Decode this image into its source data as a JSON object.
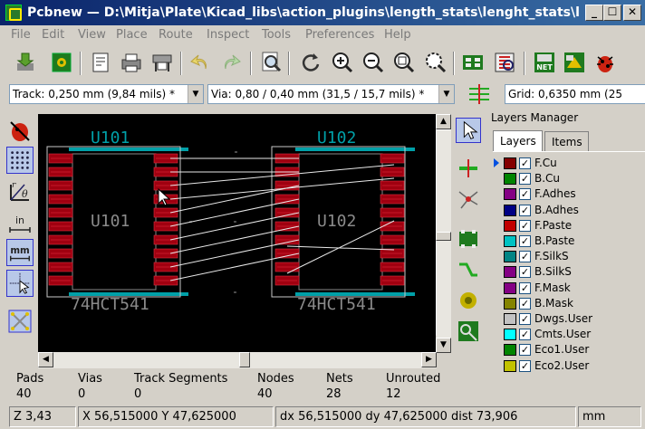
{
  "window": {
    "title": "Pcbnew — D:\\Mitja\\Plate\\Kicad_libs\\action_plugins\\length_stats\\lenght_stats\\lengh...",
    "minimize": "_",
    "maximize": "☐",
    "close": "✕"
  },
  "menu": [
    "File",
    "Edit",
    "View",
    "Place",
    "Route",
    "Inspect",
    "Tools",
    "Preferences",
    "Help"
  ],
  "toolbar_icons": [
    "new-board-icon",
    "board-setup-icon",
    "page-settings-icon",
    "print-icon",
    "plot-icon",
    "undo-icon",
    "redo-icon",
    "find-icon",
    "redraw-icon",
    "zoom-in-icon",
    "zoom-out-icon",
    "zoom-fit-icon",
    "zoom-selection-icon",
    "netlist-icon",
    "footprint-editor-icon",
    "netlist-read-icon",
    "update-pcb-icon",
    "drc-icon"
  ],
  "combos": {
    "track": "Track: 0,250 mm (9,84 mils) *",
    "via": "Via: 0,80 / 0,40 mm (31,5 / 15,7 mils) *",
    "grid": "Grid: 0,6350 mm (25"
  },
  "canvas": {
    "u101_ref_top": "U101",
    "u101_ref_center": "U101",
    "u101_value": "74HCT541",
    "u102_ref_top": "U102",
    "u102_ref_center": "U102",
    "u102_value": "74HCT541"
  },
  "layers_manager": {
    "title": "Layers Manager",
    "tabs": [
      "Layers",
      "Items"
    ],
    "selected": "F.Cu",
    "layers": [
      {
        "name": "F.Cu",
        "color": "#840000"
      },
      {
        "name": "B.Cu",
        "color": "#008400"
      },
      {
        "name": "F.Adhes",
        "color": "#840084"
      },
      {
        "name": "B.Adhes",
        "color": "#000084"
      },
      {
        "name": "F.Paste",
        "color": "#c20000"
      },
      {
        "name": "B.Paste",
        "color": "#00c2c2"
      },
      {
        "name": "F.SilkS",
        "color": "#008484"
      },
      {
        "name": "B.SilkS",
        "color": "#840084"
      },
      {
        "name": "F.Mask",
        "color": "#840084"
      },
      {
        "name": "B.Mask",
        "color": "#848400"
      },
      {
        "name": "Dwgs.User",
        "color": "#c2c2c2"
      },
      {
        "name": "Cmts.User",
        "color": "#00ffff"
      },
      {
        "name": "Eco1.User",
        "color": "#008400"
      },
      {
        "name": "Eco2.User",
        "color": "#c2c200"
      }
    ]
  },
  "stats": [
    {
      "label": "Pads",
      "value": "40"
    },
    {
      "label": "Vias",
      "value": "0"
    },
    {
      "label": "Track Segments",
      "value": "0"
    },
    {
      "label": "Nodes",
      "value": "40"
    },
    {
      "label": "Nets",
      "value": "28"
    },
    {
      "label": "Unrouted",
      "value": "12"
    }
  ],
  "status": {
    "zoom": "Z 3,43",
    "xy": "X 56,515000  Y 47,625000",
    "dxy": "dx 56,515000  dy 47,625000  dist 73,906",
    "units": "mm"
  }
}
